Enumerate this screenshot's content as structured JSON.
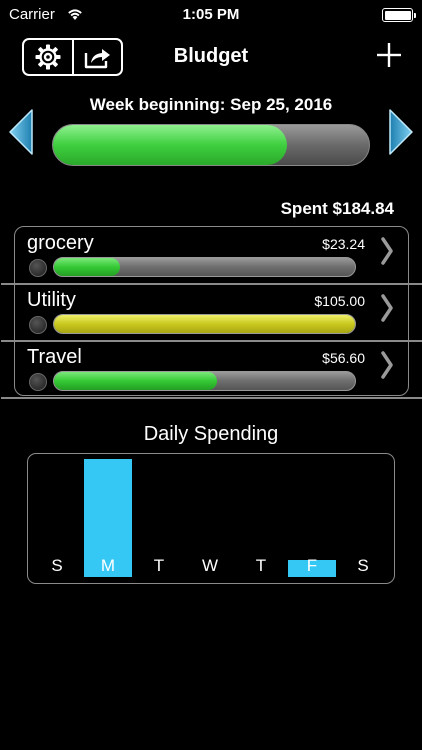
{
  "status": {
    "carrier": "Carrier",
    "time": "1:05 PM"
  },
  "nav": {
    "title": "Bludget",
    "settings_icon": "gear-icon",
    "share_icon": "share-icon",
    "add_icon": "plus-icon"
  },
  "week": {
    "label": "Week beginning: Sep 25, 2016",
    "progress": 0.74
  },
  "spent": "Spent $184.84",
  "categories": [
    {
      "name": "grocery",
      "amount": "$23.24",
      "progress": 0.22,
      "color": "#35c935"
    },
    {
      "name": "Utility",
      "amount": "$105.00",
      "progress": 1.0,
      "color": "#c9c81f"
    },
    {
      "name": "Travel",
      "amount": "$56.60",
      "progress": 0.54,
      "color": "#35c935"
    }
  ],
  "daily": {
    "title": "Daily Spending",
    "bar_color": "#36c8f5",
    "days": [
      {
        "label": "S",
        "value": 0
      },
      {
        "label": "M",
        "value": 1.0
      },
      {
        "label": "T",
        "value": 0
      },
      {
        "label": "W",
        "value": 0
      },
      {
        "label": "T",
        "value": 0
      },
      {
        "label": "F",
        "value": 0.14
      },
      {
        "label": "S",
        "value": 0
      }
    ]
  }
}
